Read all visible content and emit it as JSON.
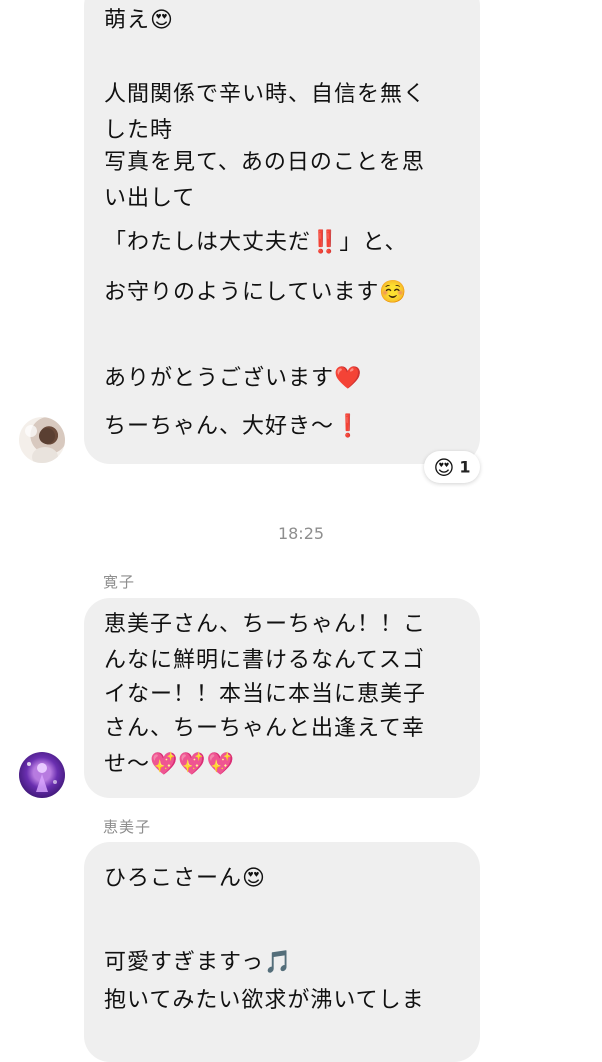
{
  "messages": [
    {
      "lines": [
        "萌え😍",
        "",
        "人間関係で辛い時、自信を無く",
        "した時",
        "写真を見て、あの日のことを思",
        "い出して",
        "「わたしは大丈夫だ‼️」と、",
        "お守りのようにしています☺️",
        "",
        "ありがとうございます❤️",
        "ちーちゃん、大好き〜❗️"
      ],
      "reaction": {
        "emoji": "😍",
        "count": "1"
      }
    },
    {
      "sender": "寛子",
      "lines": [
        "恵美子さん、ちーちゃん！！こ",
        "んなに鮮明に書けるなんてスゴ",
        "イなー！！本当に本当に恵美子",
        "さん、ちーちゃんと出逢えて幸",
        "せ〜💖💖💖"
      ]
    },
    {
      "sender": "恵美子",
      "lines": [
        "ひろこさーん😍",
        "",
        "可愛すぎますっ🎵",
        "抱いてみたい欲求が沸いてしま"
      ]
    }
  ],
  "timestamp": "18:25",
  "colors": {
    "bubble": "#efefef",
    "meta_text": "#8e8e8e",
    "background": "#ffffff"
  }
}
